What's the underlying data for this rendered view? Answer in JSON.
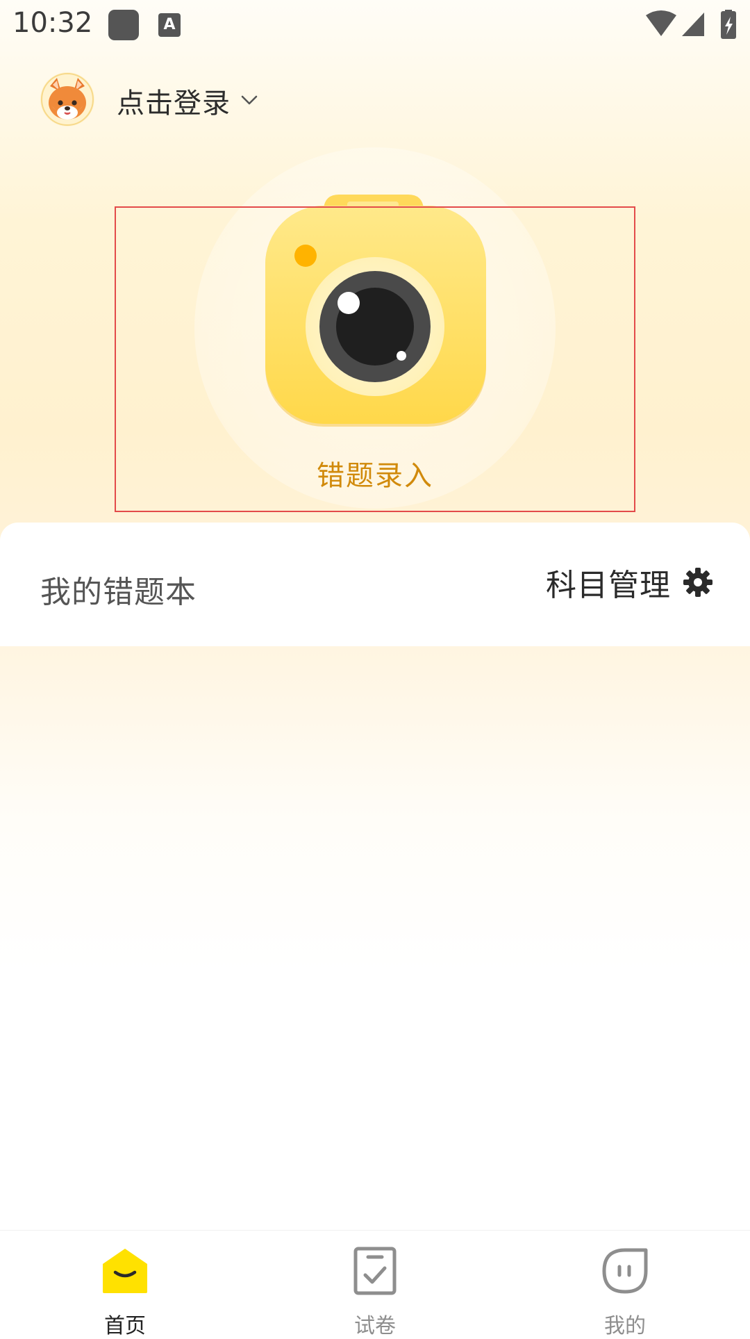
{
  "status_bar": {
    "time": "10:32",
    "app_icon_letter": "A"
  },
  "header": {
    "login_label": "点击登录"
  },
  "hero": {
    "record_label": "错题录入"
  },
  "card": {
    "title": "我的错题本",
    "subject_manage_label": "科目管理"
  },
  "bottom_nav": {
    "items": [
      {
        "label": "首页",
        "icon": "home-icon",
        "active": true
      },
      {
        "label": "试卷",
        "icon": "exam-paper-icon",
        "active": false
      },
      {
        "label": "我的",
        "icon": "profile-face-icon",
        "active": false
      }
    ]
  },
  "colors": {
    "accent_yellow": "#ffe100",
    "record_label": "#d18a0b",
    "highlight_border": "#e34a4a",
    "background_warm": "#fff1cf"
  }
}
